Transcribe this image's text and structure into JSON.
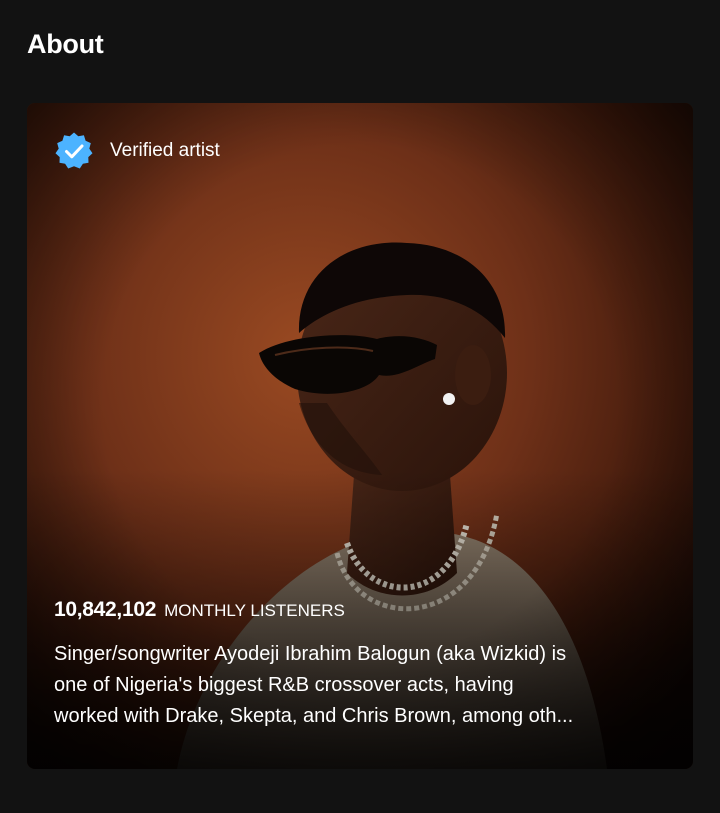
{
  "about": {
    "title": "About",
    "verified_label": "Verified artist",
    "monthly_listeners": "10,842,102",
    "monthly_listeners_label": "MONTHLY LISTENERS",
    "bio_lines": [
      "Singer/songwriter Ayodeji Ibrahim Balogun (aka Wizkid) is",
      "one of Nigeria's biggest R&B crossover acts, having",
      "worked with Drake, Skepta, and Chris Brown, among oth..."
    ]
  },
  "icons": {
    "verified": "verified-badge-icon"
  },
  "colors": {
    "page_background": "#121212",
    "verified_badge": "#4cb3ff",
    "text": "#ffffff"
  }
}
